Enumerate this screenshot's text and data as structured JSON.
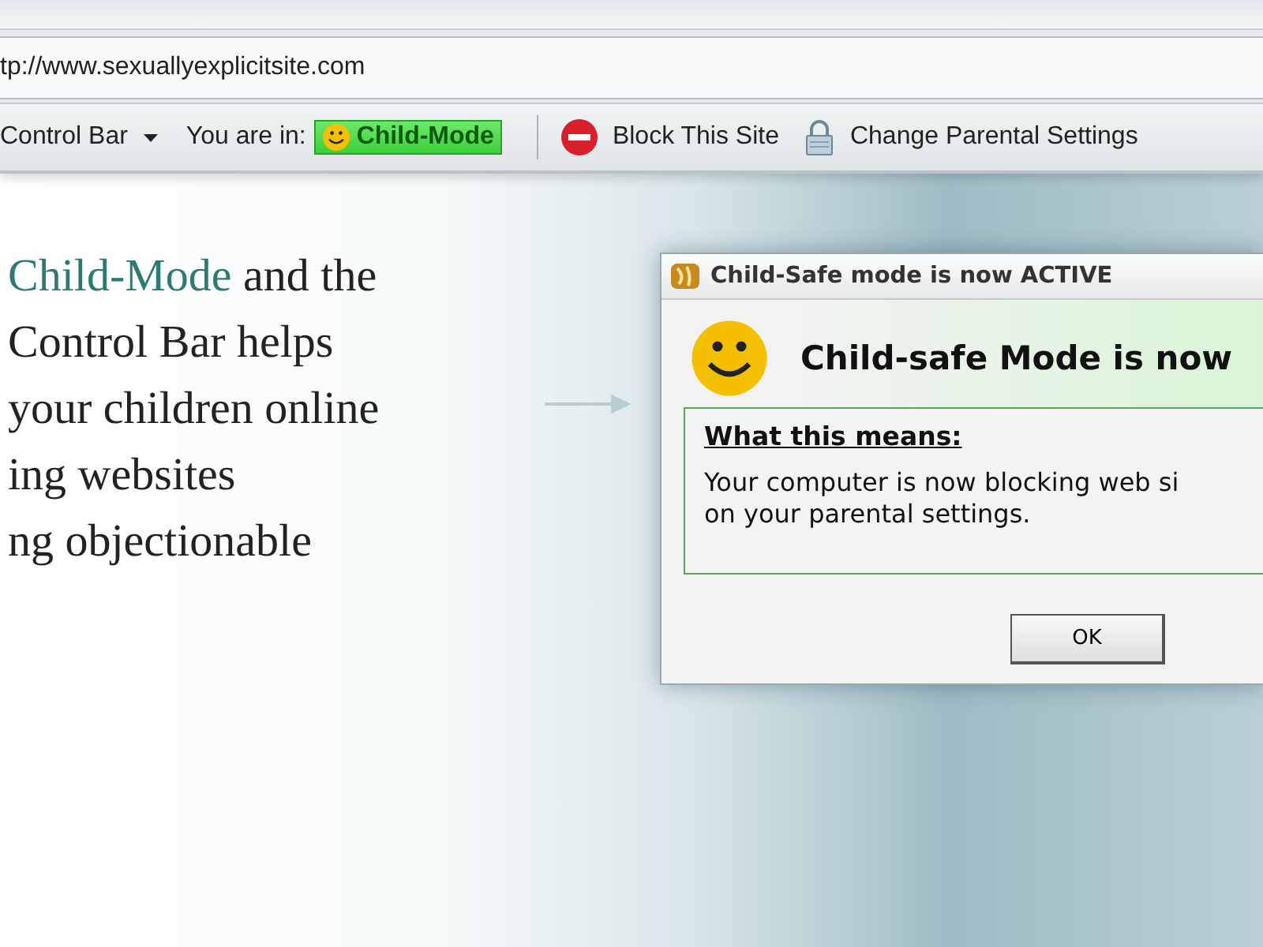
{
  "address_bar": {
    "url": "tp://www.sexuallyexplicitsite.com"
  },
  "toolbar": {
    "menu_label": "Control Bar",
    "status_label": "You are in:",
    "mode_badge": "Child-Mode",
    "actions": [
      {
        "kind": "block",
        "label": "Block This Site"
      },
      {
        "kind": "lock",
        "label": "Change Parental Settings"
      }
    ]
  },
  "intro": {
    "lines": [
      "**Child-Mode** and the",
      "Control Bar helps",
      "your children online",
      "ing websites",
      "ng objectionable"
    ]
  },
  "dialog": {
    "title": "Child-Safe mode is now ACTIVE",
    "heading": "Child-safe Mode is now",
    "section_title": "What this means:",
    "body_lines": [
      "Your computer is now blocking web si",
      "on your parental settings."
    ],
    "buttons": [
      "OK"
    ]
  }
}
